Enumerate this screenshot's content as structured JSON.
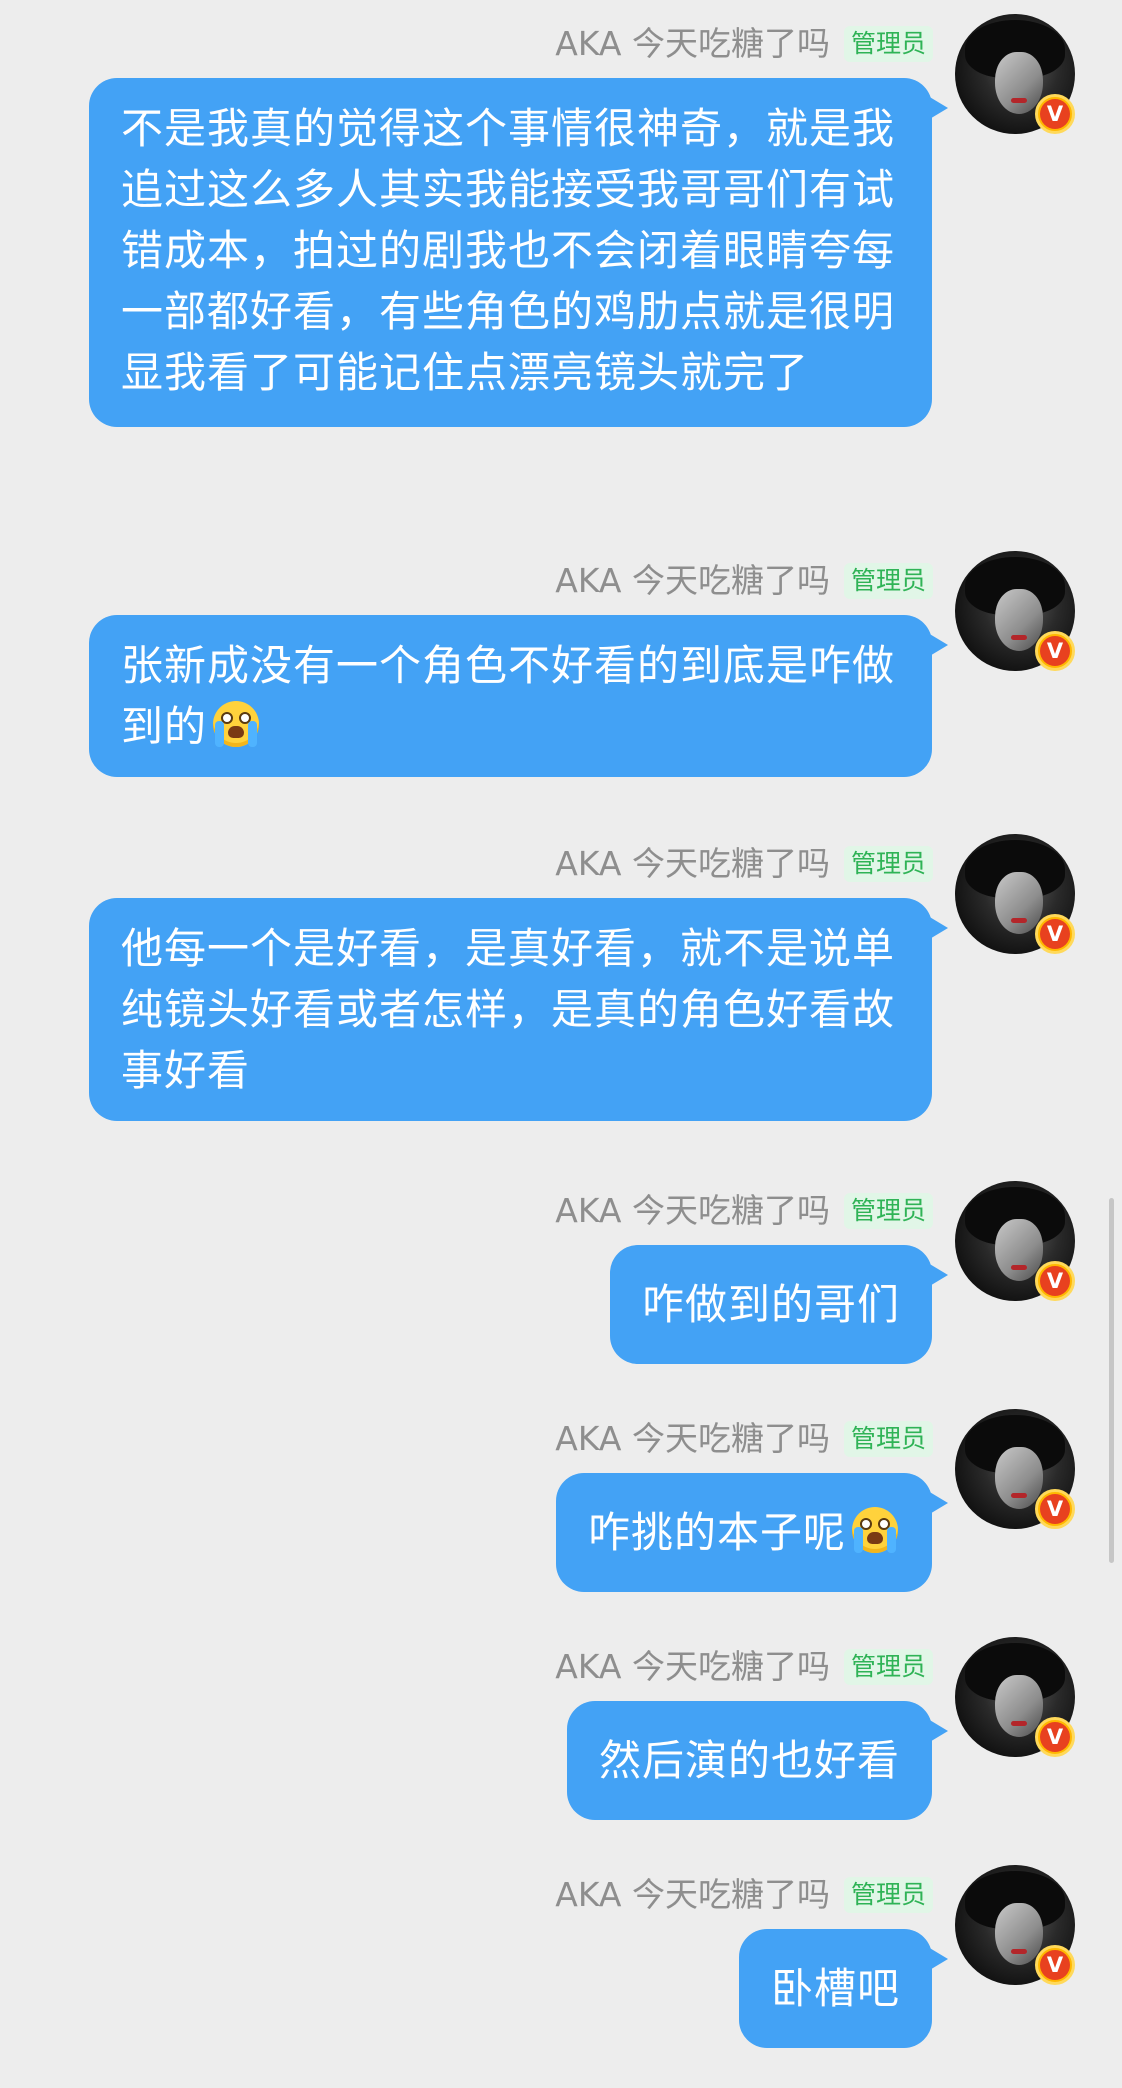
{
  "role_badge": "管理员",
  "verified_mark": "V",
  "colors": {
    "background": "#ededed",
    "bubble": "#43a2f5",
    "bubble_text": "#ffffff",
    "sender_name": "#8e8e8e",
    "badge_bg": "#e1f6e7",
    "badge_text": "#2fb356"
  },
  "messages": [
    {
      "sender": "AKA 今天吃糖了吗",
      "text": "不是我真的觉得这个事情很神奇，就是我追过这么多人其实我能接受我哥哥们有试错成本，拍过的剧我也不会闭着眼睛夸每一部都好看，有些角色的鸡肋点就是很明显我看了可能记住点漂亮镜头就完了",
      "emoji": ""
    },
    {
      "sender": "AKA 今天吃糖了吗",
      "text": "张新成没有一个角色不好看的到底是咋做到的",
      "emoji": "crying-face-emoji"
    },
    {
      "sender": "AKA 今天吃糖了吗",
      "text": "他每一个是好看，是真好看，就不是说单纯镜头好看或者怎样，是真的角色好看故事好看",
      "emoji": ""
    },
    {
      "sender": "AKA 今天吃糖了吗",
      "text": "咋做到的哥们",
      "emoji": ""
    },
    {
      "sender": "AKA 今天吃糖了吗",
      "text": "咋挑的本子呢",
      "emoji": "crying-face-emoji"
    },
    {
      "sender": "AKA 今天吃糖了吗",
      "text": "然后演的也好看",
      "emoji": ""
    },
    {
      "sender": "AKA 今天吃糖了吗",
      "text": "卧槽吧",
      "emoji": ""
    }
  ]
}
